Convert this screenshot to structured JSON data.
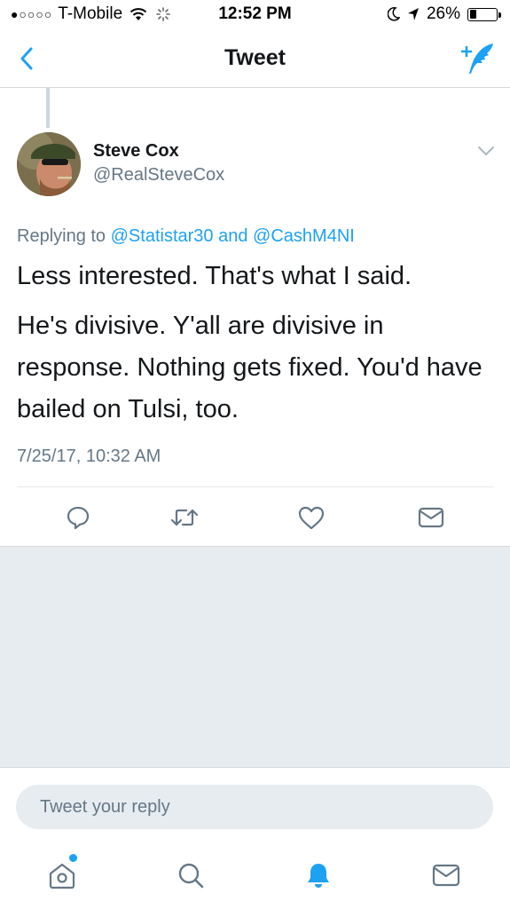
{
  "status_bar": {
    "signal_dots": "●○○○○",
    "carrier": "T-Mobile",
    "time": "12:52 PM",
    "battery_percent": "26%",
    "battery_level": 0.26
  },
  "nav": {
    "title": "Tweet",
    "back_icon": "chevron-left-icon",
    "compose_icon": "compose-tweet-icon"
  },
  "tweet": {
    "author_name": "Steve Cox",
    "author_handle": "@RealSteveCox",
    "replying_prefix": "Replying to",
    "mention_1": "@Statistar30",
    "replying_joiner": "and",
    "mention_2": "@CashM4NI",
    "paragraph_1": "Less interested. That's what I said.",
    "paragraph_2": "He's divisive. Y'all are divisive in response. Nothing gets fixed. You'd have bailed on Tulsi, too.",
    "timestamp": "7/25/17, 10:32 AM"
  },
  "actions": [
    "reply-icon",
    "retweet-icon",
    "like-icon",
    "direct-message-icon"
  ],
  "reply_box": {
    "placeholder": "Tweet your reply",
    "value": ""
  },
  "tabbar": [
    "home-icon",
    "search-icon",
    "notifications-icon",
    "messages-icon"
  ],
  "colors": {
    "accent": "#1da1f2",
    "secondary_text": "#657786",
    "icon_grey": "#657786",
    "background_grey": "#e6ecf0"
  }
}
